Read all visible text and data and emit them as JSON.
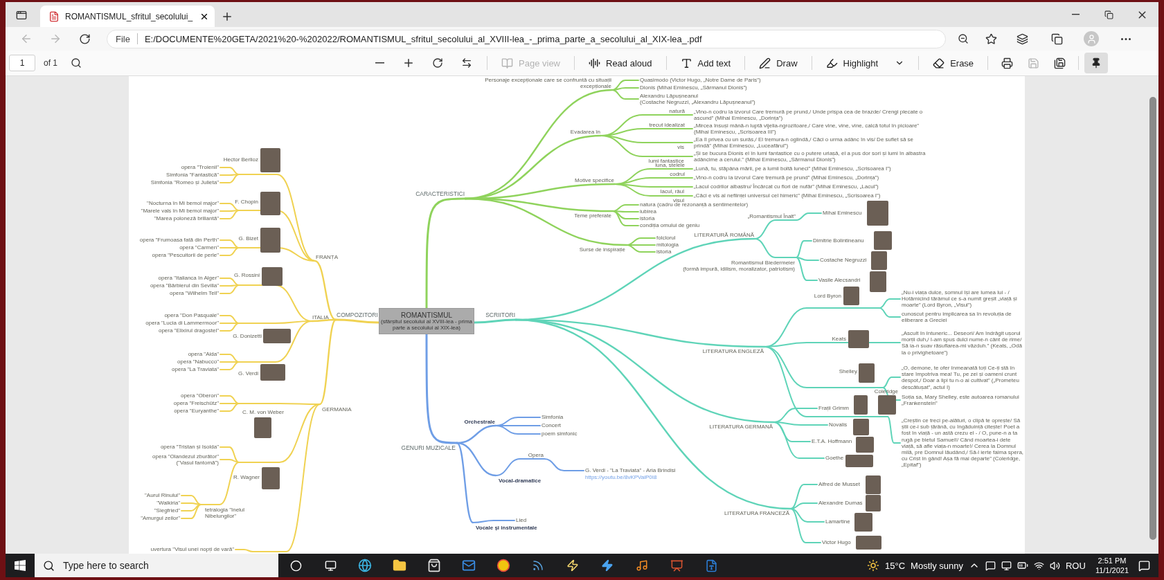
{
  "browser": {
    "tab_title": "ROMANTISMUL_sfritul_secolului_",
    "address_label": "File",
    "url": "E:/DOCUMENTE%20GETA/2021%20-%202022/ROMANTISMUL_sfritul_secolului_al_XVIII-lea_-_prima_parte_a_secolului_al_XIX-lea_.pdf"
  },
  "pdf_toolbar": {
    "page": "1",
    "page_count": "of 1",
    "tools": [
      {
        "kind": "page-view",
        "label": "Page view",
        "disabled": true
      },
      {
        "kind": "read-aloud",
        "label": "Read aloud",
        "disabled": false
      },
      {
        "kind": "add-text",
        "label": "Add text",
        "disabled": false
      },
      {
        "kind": "draw",
        "label": "Draw",
        "disabled": false
      },
      {
        "kind": "highlight",
        "label": "Highlight",
        "disabled": false
      },
      {
        "kind": "erase",
        "label": "Erase",
        "disabled": false
      }
    ]
  },
  "mindmap": {
    "root": {
      "title": "ROMANTISMUL",
      "subtitle": "(sfârșitul secolului al XVIII-lea - prima parte a secolului al XIX-lea)"
    },
    "branches": [
      {
        "label": "CARACTERISTICI",
        "color": "#8fd35c",
        "children": [
          {
            "label": "Personaje excepționale care se confruntă cu situații\nexcepționale",
            "children": [
              {
                "label": "Quasimodo (Victor Hugo, „Notre Dame de Paris”)"
              },
              {
                "label": "Dionis (Mihai Eminescu, „Sărmanul Dionis”)"
              },
              {
                "label": "Alexandru Lăpușneanul\n(Costache Negruzzi, „Alexandru Lăpușneanul”)"
              }
            ]
          },
          {
            "label": "Evadarea în",
            "children": [
              {
                "label": "natură",
                "children": [
                  {
                    "label": "„Vino-n codru la izvorul Care tremură pe prund,/ Unde prispa cea de brazde/ Crengi plecate o ascund” (Mihai Eminescu, „Dorința”)"
                  }
                ]
              },
              {
                "label": "trecut idealizat",
                "children": [
                  {
                    "label": "„Mircea însuși mână-n luptă vijelia-ngrozitoare,/ Care vine, vine, vine, calcă totul în picioare” (Mihai Eminescu, „Scrisoarea III”)"
                  }
                ]
              },
              {
                "label": "vis",
                "children": [
                  {
                    "label": "„Ea îl privea cu un surâs,/ El tremura-n oglindă,/ Căci o urma adânc în vis/ De suflet să se prindă” (Mihai Eminescu, „Luceafărul”)"
                  }
                ]
              },
              {
                "label": "lumi fantastice",
                "children": [
                  {
                    "label": "„Și se bucura Dionis el în lumi fantastice cu o putere uriașă, el a pus dor sori și lumi în albastra adâncime a cerului.” (Mihai Eminescu, „Sărmanul Dionis”)"
                  }
                ]
              }
            ]
          },
          {
            "label": "Motive specifice",
            "children": [
              {
                "label": "luna, stelele",
                "children": [
                  {
                    "label": "„Lună, tu, stăpâna mării, pe a lumii boltă luneci” (Mihai Eminescu, „Scrisoarea I”)"
                  }
                ]
              },
              {
                "label": "codrul",
                "children": [
                  {
                    "label": "„Vino-n codru la izvorul Care tremură pe prund” (Mihai Eminescu, „Dorința”)"
                  }
                ]
              },
              {
                "label": "lacul, râul",
                "children": [
                  {
                    "label": "„Lacul codrilor albastru/ Încărcat cu flori de nufăr” (Mihai Eminescu, „Lacul”)"
                  }
                ]
              },
              {
                "label": "visul",
                "children": [
                  {
                    "label": "„Căci e vis al neființei universul cel himeric” (Mihai Eminescu, „Scrisoarea I”)"
                  }
                ]
              }
            ]
          },
          {
            "label": "Teme preferate",
            "children": [
              {
                "label": "natura (cadru de rezonanță a sentimentelor)"
              },
              {
                "label": "iubirea"
              },
              {
                "label": "istoria"
              },
              {
                "label": "condiția omului de geniu"
              }
            ]
          },
          {
            "label": "Surse de inspirație",
            "children": [
              {
                "label": "folclorul"
              },
              {
                "label": "mitologia"
              },
              {
                "label": "istoria"
              }
            ]
          }
        ]
      },
      {
        "label": "SCRIITORI",
        "color": "#5fd4b8",
        "children": [
          {
            "label": "LITERATURĂ ROMÂNĂ",
            "children": [
              {
                "label": "„Romantismul Înalt”",
                "children": [
                  {
                    "label": "Mihai Eminescu",
                    "portrait": true
                  }
                ]
              },
              {
                "label": "Romantismul Biedermeier\n(formă impură, idilism, moralizator, patriotism)",
                "children": [
                  {
                    "label": "Dimitrie Bolintineanu",
                    "portrait": true
                  },
                  {
                    "label": "Costache Negruzzi",
                    "portrait": true
                  },
                  {
                    "label": "Vasile Alecsandri",
                    "portrait": true
                  }
                ]
              }
            ]
          },
          {
            "label": "LITERATURA ENGLEZĂ",
            "children": [
              {
                "label": "Lord Byron",
                "portrait": true,
                "children": [
                  {
                    "label": "„Nu-i viața dulce, somnul își are lumea lui - / Hotărnicind tărâmul ce s-a numit greșit „viață și moarte” (Lord Byron, „Visul”)"
                  },
                  {
                    "label": "cunoscut pentru implicarea sa în revoluția de eliberare a Greciei"
                  }
                ]
              },
              {
                "label": "Keats",
                "portrait": true,
                "children": [
                  {
                    "label": "„Ascult în întuneric... Deseori/ Am îndrăgit ușorul morții duh,/ I-am spus dulci nume-n cânt de rime/ Să ia-n suav răsuflarea-mi văzduh.” (Keats, „Odă la o privighetoare”)"
                  }
                ]
              },
              {
                "label": "Shelley",
                "portrait": true,
                "children": [
                  {
                    "label": "„O, demone, te ofer înmeanată toți Ce-ți stă în stare împotriva mea! Tu, pe zei și oameni crunt despot,/ Doar a lipi tu n-o ai cultivat” („Prometeu descătușat”, actul I)"
                  },
                  {
                    "label": "Soția sa, Mary Shelley, este autoarea romanului „Frankenstein”"
                  }
                ]
              },
              {
                "label": "Coleridge",
                "portrait": true,
                "children": [
                  {
                    "label": "„Creștin ce treci pe-alături, o clipă te oprește/ Să știi ce-i sub țărână, cu îngăduință citește! Poet a fost în viață - un astă crezu el - / O, pune-n a ta rugă pe bietul Samuel!/ Când moartea-i dete viață, să afle viața-n moarte!/ Cerea la Domnul milă, pre Domnul lăudând,/ Să-l ierte faima spera, cu Crist în gând! Așa fă mai departe” (Coleridge, „Epitaf”)"
                  }
                ]
              }
            ]
          },
          {
            "label": "LITERATURA GERMANĂ",
            "children": [
              {
                "label": "Frații Grimm",
                "portrait": true
              },
              {
                "label": "Novalis",
                "portrait": true
              },
              {
                "label": "E.T.A. Hoffmann",
                "portrait": true
              },
              {
                "label": "Goethe",
                "portrait": true
              }
            ]
          },
          {
            "label": "LITERATURA FRANCEZĂ",
            "children": [
              {
                "label": "Alfred de Musset",
                "portrait": true
              },
              {
                "label": "Alexandre Dumas",
                "portrait": true
              },
              {
                "label": "Lamartine",
                "portrait": true
              },
              {
                "label": "Victor Hugo",
                "portrait": true
              }
            ]
          }
        ]
      },
      {
        "label": "GENURI MUZICALE",
        "color": "#6f9ee6",
        "children": [
          {
            "label": "Orchestrale",
            "children": [
              {
                "label": "Simfonia"
              },
              {
                "label": "Concert"
              },
              {
                "label": "poem simfonic"
              }
            ]
          },
          {
            "label": "Vocal-dramatice",
            "children": [
              {
                "label": "Opera",
                "children": [
                  {
                    "label": "G. Verdi - \"La Traviata\" - Aria Brindisi",
                    "link": "https://youtu.be/8vKPVaiP0I8"
                  }
                ]
              }
            ]
          },
          {
            "label": "Vocale și instrumentale",
            "children": [
              {
                "label": "Lied"
              }
            ]
          }
        ]
      },
      {
        "label": "COMPOZITORI",
        "color": "#f0d252",
        "children": [
          {
            "label": "FRANȚA",
            "children": [
              {
                "label": "Hector Berlioz",
                "portrait": true,
                "children": [
                  {
                    "label": "opera \"Troienii\""
                  },
                  {
                    "label": "Simfonia \"Fantastică\""
                  },
                  {
                    "label": "Simfonia \"Romeo și Julieta\""
                  }
                ]
              },
              {
                "label": "F. Chopin",
                "portrait": true,
                "children": [
                  {
                    "label": "\"Nocturna în Mi bemol major\""
                  },
                  {
                    "label": "\"Marele vals în Mi bemol major\""
                  },
                  {
                    "label": "\"Marea poloneză briliantă\""
                  }
                ]
              },
              {
                "label": "G. Bizet",
                "portrait": true,
                "children": [
                  {
                    "label": "opera \"Frumoasa fată din Perth\""
                  },
                  {
                    "label": "opera \"Carmen\""
                  },
                  {
                    "label": "opera \"Pescuitorii de perle\""
                  }
                ]
              }
            ]
          },
          {
            "label": "ITALIA",
            "children": [
              {
                "label": "G. Rossini",
                "portrait": true,
                "children": [
                  {
                    "label": "opera \"Italianca în Alger\""
                  },
                  {
                    "label": "opera \"Bărbierul din Sevilla\""
                  },
                  {
                    "label": "opera \"Wilhelm Tell\""
                  }
                ]
              },
              {
                "label": "G. Donizetti",
                "portrait": true,
                "children": [
                  {
                    "label": "opera \"Don Pasquale\""
                  },
                  {
                    "label": "opera \"Lucia di Lammermoor\""
                  },
                  {
                    "label": "opera \"Elixirul dragostei\""
                  }
                ]
              },
              {
                "label": "G. Verdi",
                "portrait": true,
                "children": [
                  {
                    "label": "opera \"Aida\""
                  },
                  {
                    "label": "opera \"Nabucco\""
                  },
                  {
                    "label": "opera \"La Traviata\""
                  }
                ]
              }
            ]
          },
          {
            "label": "GERMANIA",
            "children": [
              {
                "label": "C. M. von Weber",
                "portrait": true,
                "children": [
                  {
                    "label": "opera \"Oberon\""
                  },
                  {
                    "label": "opera \"Freischütz\""
                  },
                  {
                    "label": "opera \"Euryanthe\""
                  }
                ]
              },
              {
                "label": "R. Wagner",
                "portrait": true,
                "children": [
                  {
                    "label": "opera \"Tristan și Isolda\""
                  },
                  {
                    "label": "opera \"Olandezul zburător\" (\"Vasul fantomă\")"
                  },
                  {
                    "label": "tetralogia \"Inelul Nibelungilor\"",
                    "children": [
                      {
                        "label": "\"Aurul Rinului\""
                      },
                      {
                        "label": "\"Walkiria\""
                      },
                      {
                        "label": "\"Siegfried\""
                      },
                      {
                        "label": "\"Amurgul zeilor\""
                      }
                    ]
                  }
                ]
              },
              {
                "children": [
                  {
                    "label": "uvertura \"Visul unei nopți de vară\""
                  }
                ]
              }
            ]
          }
        ]
      }
    ]
  },
  "taskbar": {
    "search_placeholder": "Type here to search",
    "temperature": "15°C",
    "weather": "Mostly sunny",
    "language": "ROU",
    "time": "2:51 PM",
    "date": "11/1/2021"
  }
}
